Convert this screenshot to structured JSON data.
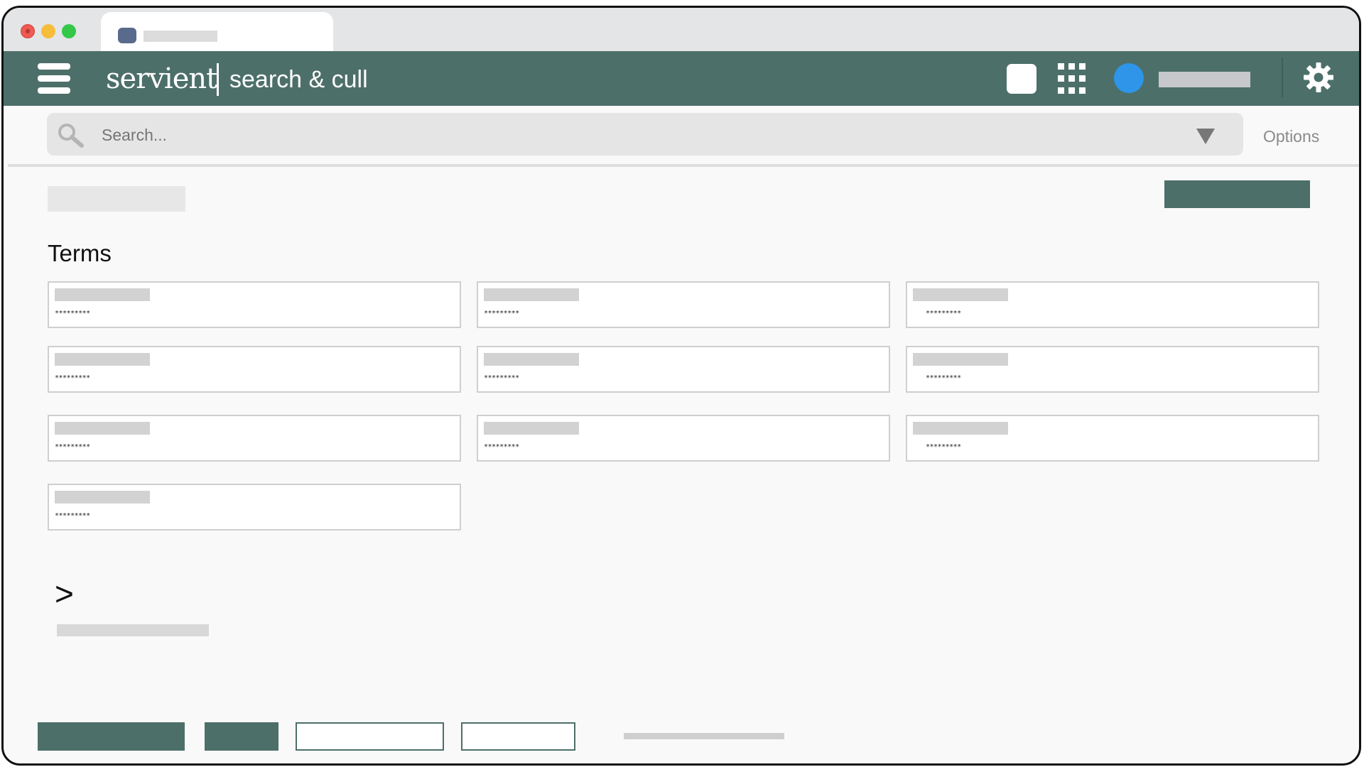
{
  "window": {
    "controls": [
      "close",
      "minimize",
      "zoom"
    ],
    "tab": {
      "favicon": "app-favicon",
      "title": ""
    }
  },
  "header": {
    "brand": "servient",
    "product": "search & cull",
    "icons": [
      "menu-icon",
      "square-icon",
      "apps-grid-icon",
      "avatar",
      "gear-icon"
    ],
    "accent_color": "#4d6f69",
    "avatar_color": "#2e95e8"
  },
  "search": {
    "placeholder": "Search...",
    "options_label": "Options"
  },
  "main": {
    "section_title": "Terms",
    "terms": [
      {
        "value": "*********"
      },
      {
        "value": "*********"
      },
      {
        "value": "*********"
      },
      {
        "value": "*********"
      },
      {
        "value": "*********"
      },
      {
        "value": "*********"
      },
      {
        "value": "*********"
      },
      {
        "value": "*********"
      },
      {
        "value": "*********"
      },
      {
        "value": "*********"
      }
    ],
    "expand_glyph": ">"
  }
}
